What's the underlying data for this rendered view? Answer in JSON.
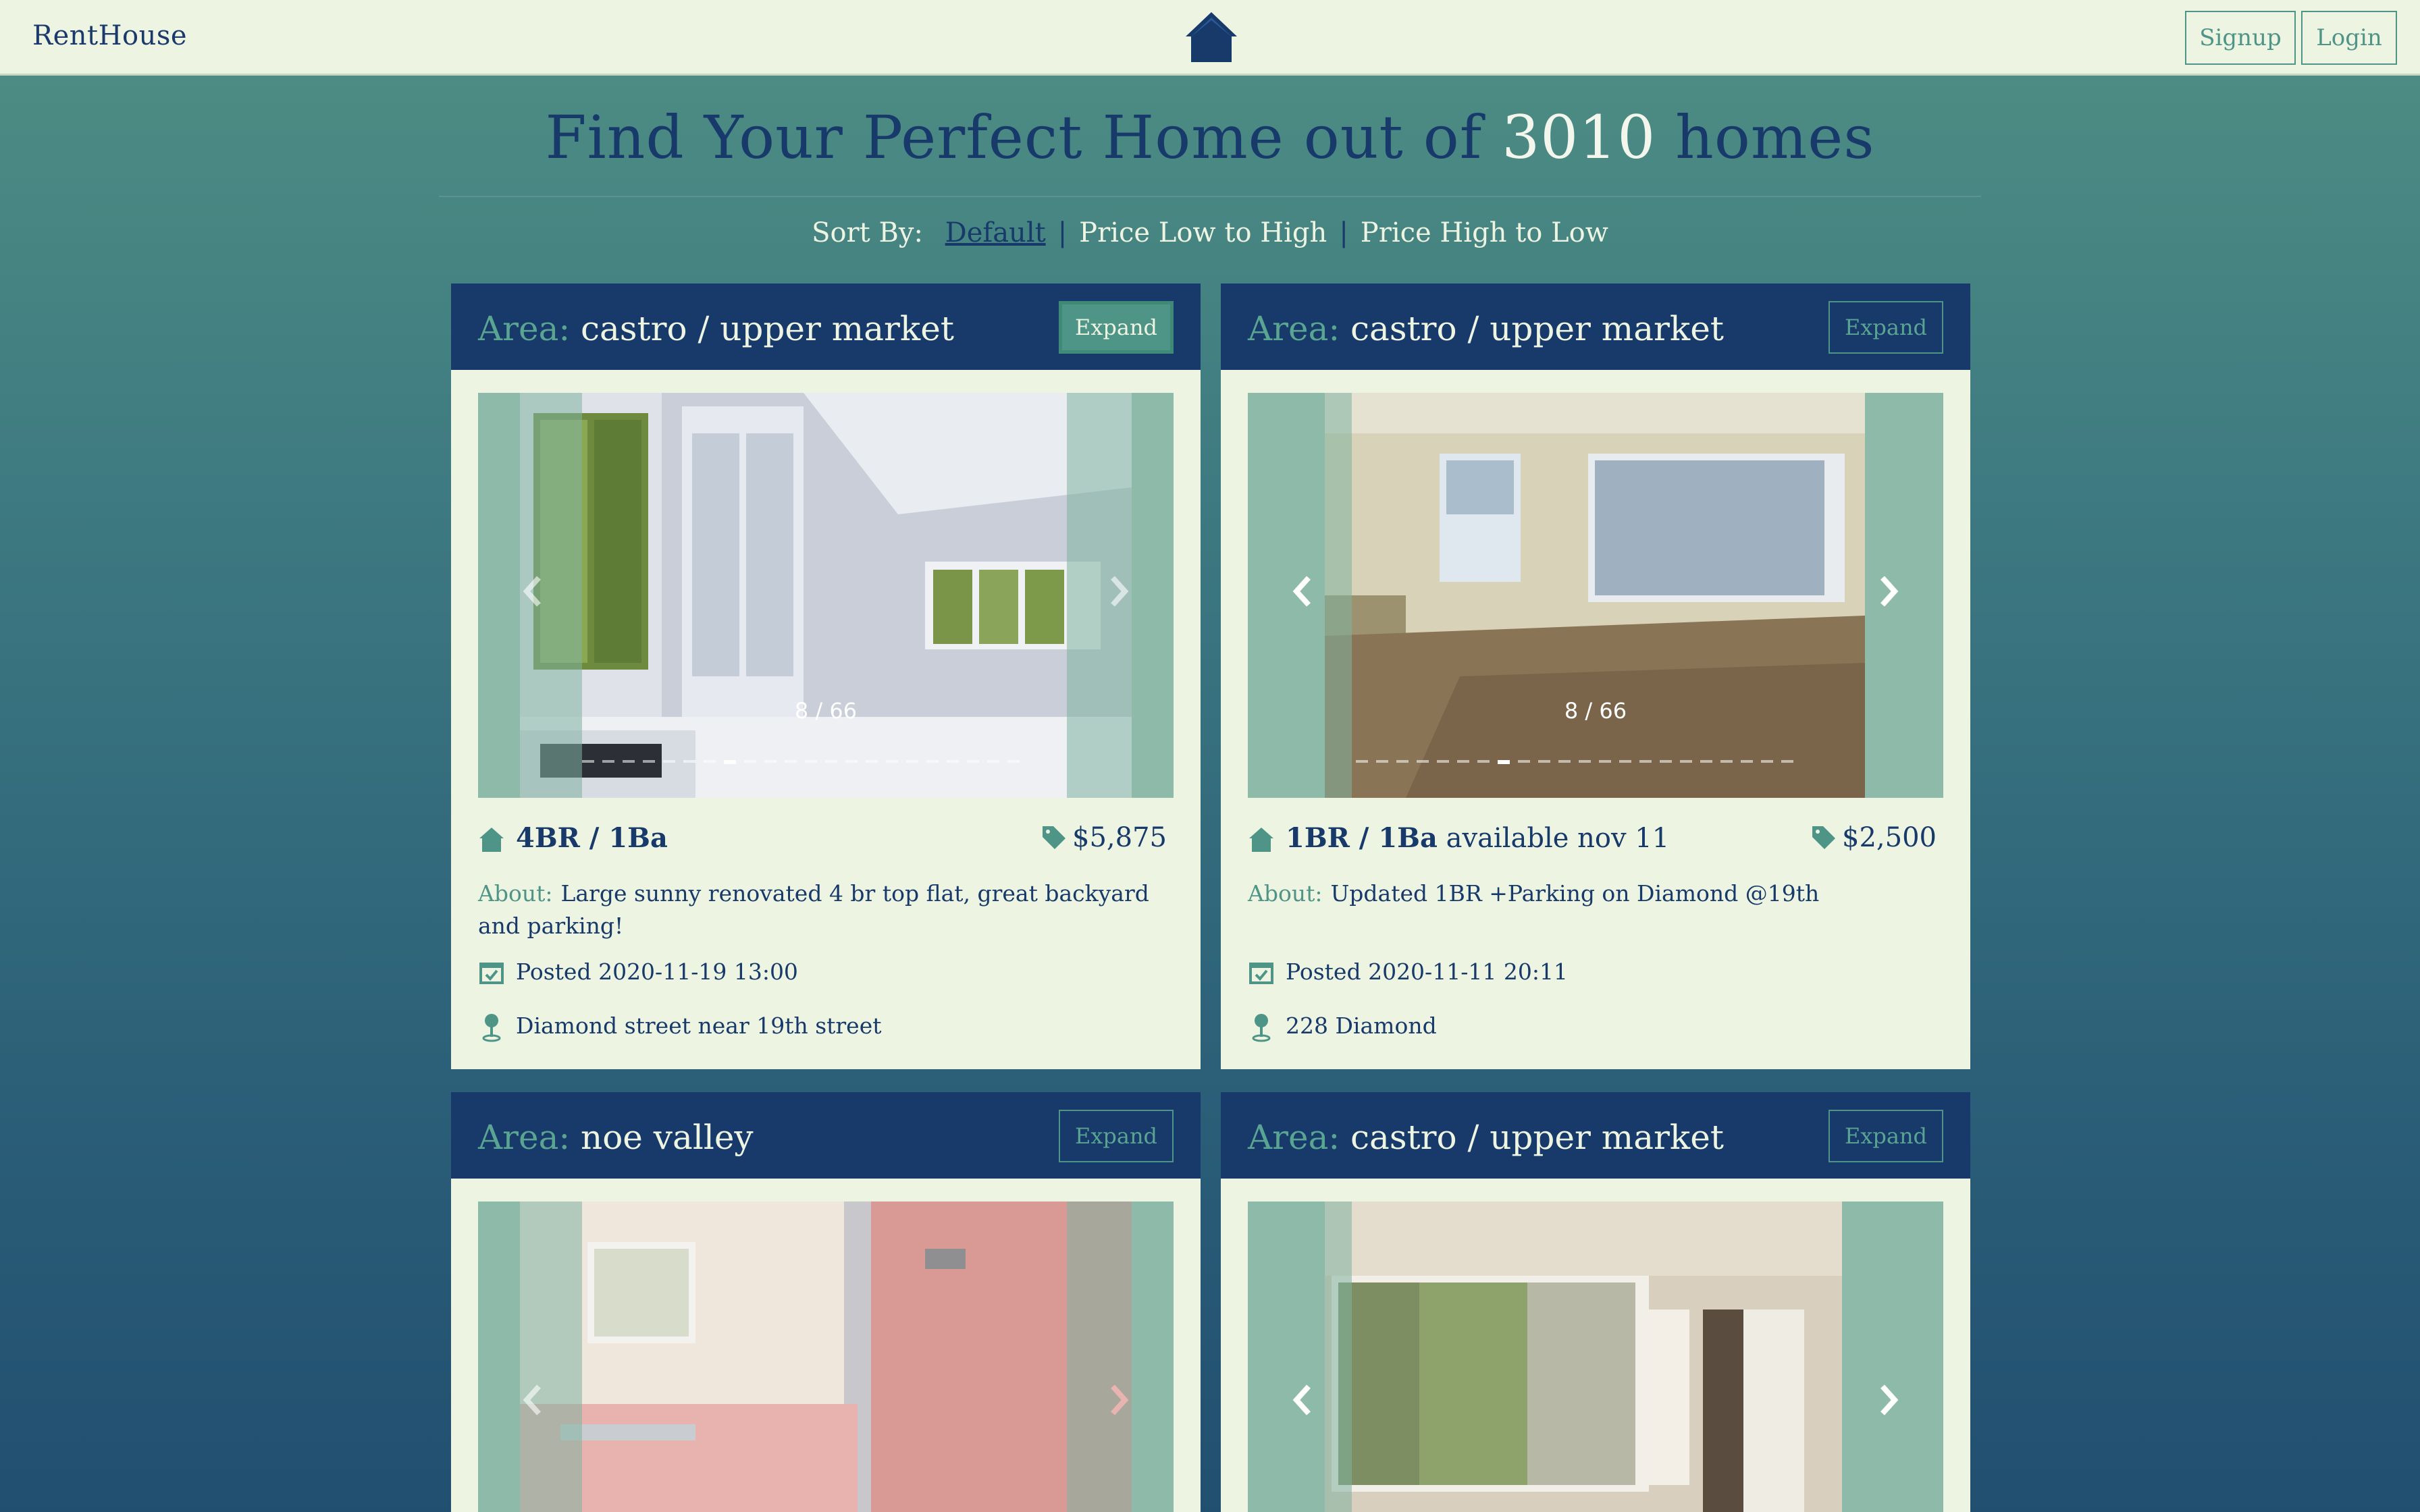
{
  "nav": {
    "brand": "RentHouse",
    "signup": "Signup",
    "login": "Login"
  },
  "hero": {
    "title_prefix": "Find Your Perfect Home out of ",
    "count": "3010",
    "title_suffix": " homes"
  },
  "sort": {
    "label": "Sort By:",
    "options": [
      "Default",
      "Price Low to High",
      "Price High to Low"
    ],
    "active": "Default"
  },
  "colors": {
    "navy": "#173a6b",
    "teal": "#4e9588",
    "cream": "#eef4e2"
  },
  "cards": [
    {
      "area_label": "Area:",
      "area": "castro / upper market",
      "expand": "Expand",
      "counter": "8 / 66",
      "beds": "4BR / 1Ba",
      "beds_extra": "",
      "price": "$5,875",
      "about_label": "About:",
      "about": "Large sunny renovated 4 br top flat, great backyard and parking!",
      "posted": "Posted 2020-11-19 13:00",
      "location": "Diamond street near 19th street"
    },
    {
      "area_label": "Area:",
      "area": "castro / upper market",
      "expand": "Expand",
      "counter": "8 / 66",
      "beds": "1BR / 1Ba",
      "beds_extra": " available nov 11",
      "price": "$2,500",
      "about_label": "About:",
      "about": "Updated 1BR +Parking on Diamond @19th",
      "posted": "Posted 2020-11-11 20:11",
      "location": "228 Diamond"
    },
    {
      "area_label": "Area:",
      "area": "noe valley",
      "expand": "Expand"
    },
    {
      "area_label": "Area:",
      "area": "castro / upper market",
      "expand": "Expand"
    }
  ]
}
